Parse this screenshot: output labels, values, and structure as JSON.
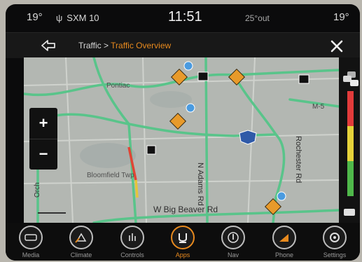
{
  "status_bar": {
    "temp_left": "19°",
    "radio": "SXM 10",
    "clock": "11:51",
    "outside_temp": "25°out",
    "temp_right": "19°"
  },
  "header": {
    "breadcrumb_parent": "Traffic",
    "breadcrumb_separator": " > ",
    "breadcrumb_current": "Traffic Overview",
    "accent_color": "#e88a1e"
  },
  "map": {
    "labels": {
      "pontiac": "Pontiac",
      "bloomfield": "Bloomfield Twp",
      "adams": "N Adams Rd",
      "rochester": "Rochester Rd",
      "beaver": "W Big Beaver Rd",
      "orchard": "Orch",
      "m5": "M-5"
    },
    "zoom_in": "+",
    "zoom_out": "−"
  },
  "traffic_legend": {
    "colors": [
      "#e23b3b",
      "#e5d23a",
      "#4fb84a"
    ]
  },
  "nav": {
    "items": [
      {
        "label": "Media",
        "icon": "media-icon"
      },
      {
        "label": "Climate",
        "icon": "climate-icon"
      },
      {
        "label": "Controls",
        "icon": "controls-icon"
      },
      {
        "label": "Apps",
        "icon": "apps-icon",
        "active": true
      },
      {
        "label": "Nav",
        "icon": "nav-icon"
      },
      {
        "label": "Phone",
        "icon": "phone-icon"
      },
      {
        "label": "Settings",
        "icon": "settings-icon"
      }
    ]
  }
}
